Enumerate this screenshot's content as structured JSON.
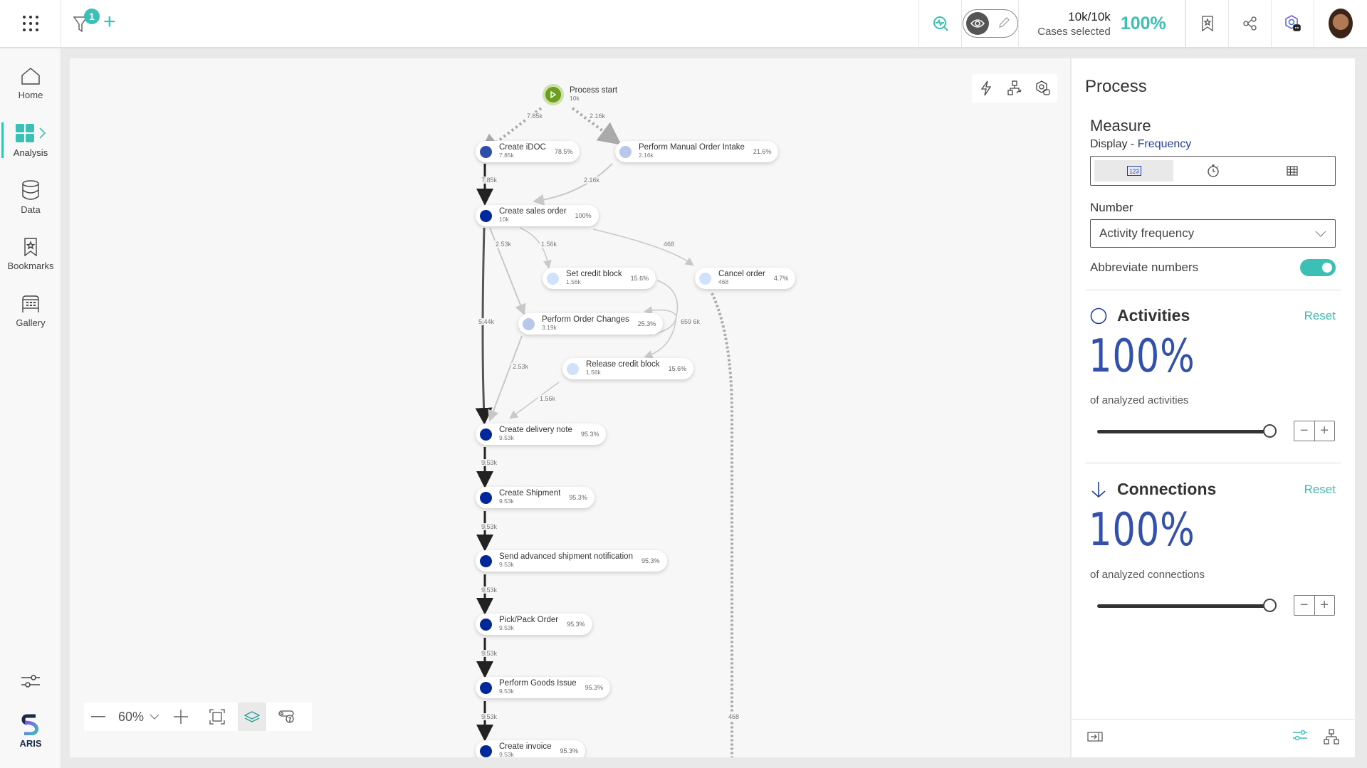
{
  "topbar": {
    "filter_count": "1",
    "cases_count": "10k/10k",
    "cases_label": "Cases selected",
    "cases_percent": "100%",
    "icons": [
      "apps-grid-icon",
      "filter-icon",
      "add-filter-icon",
      "analysis-search-icon",
      "view-mode-eye-icon",
      "edit-mode-pencil-icon",
      "bookmark-icon",
      "share-icon",
      "ai-assistant-icon",
      "user-avatar"
    ]
  },
  "sidebar": {
    "items": [
      {
        "label": "Home",
        "icon": "home-icon"
      },
      {
        "label": "Analysis",
        "icon": "analysis-grid-icon",
        "active": true
      },
      {
        "label": "Data",
        "icon": "database-icon"
      },
      {
        "label": "Bookmarks",
        "icon": "bookmark-icon"
      },
      {
        "label": "Gallery",
        "icon": "gallery-icon"
      }
    ],
    "bottom": {
      "settings_icon": "sliders-icon",
      "logo_label": "ARIS"
    }
  },
  "canvas": {
    "start": {
      "name": "Process start",
      "count": "10k"
    },
    "nodes": [
      {
        "id": "idoc",
        "name": "Create iDOC",
        "count": "7.85k",
        "pct": "78.5%",
        "color": "#2e4ea8"
      },
      {
        "id": "manual",
        "name": "Perform Manual Order Intake",
        "count": "2.16k",
        "pct": "21.6%",
        "color": "#b9c8ea"
      },
      {
        "id": "sales",
        "name": "Create sales order",
        "count": "10k",
        "pct": "100%",
        "color": "#00289a"
      },
      {
        "id": "setcb",
        "name": "Set credit block",
        "count": "1.56k",
        "pct": "15.6%",
        "color": "#cfe1fb"
      },
      {
        "id": "cancel",
        "name": "Cancel order",
        "count": "468",
        "pct": "4.7%",
        "color": "#cfe1fb"
      },
      {
        "id": "changes",
        "name": "Perform Order Changes",
        "count": "3.19k",
        "pct": "25.3%",
        "color": "#b9c8ea"
      },
      {
        "id": "relcb",
        "name": "Release credit block",
        "count": "1.56k",
        "pct": "15.6%",
        "color": "#cfe1fb"
      },
      {
        "id": "delivery",
        "name": "Create delivery note",
        "count": "9.53k",
        "pct": "95.3%",
        "color": "#00289a"
      },
      {
        "id": "shipment",
        "name": "Create Shipment",
        "count": "9.53k",
        "pct": "95.3%",
        "color": "#00289a"
      },
      {
        "id": "asn",
        "name": "Send advanced shipment notification",
        "count": "9.53k",
        "pct": "95.3%",
        "color": "#00289a"
      },
      {
        "id": "pick",
        "name": "Pick/Pack Order",
        "count": "9.53k",
        "pct": "95.3%",
        "color": "#00289a"
      },
      {
        "id": "goods",
        "name": "Perform Goods Issue",
        "count": "9.53k",
        "pct": "95.3%",
        "color": "#00289a"
      },
      {
        "id": "invoice",
        "name": "Create invoice",
        "count": "9.53k",
        "pct": "95.3%",
        "color": "#00289a"
      }
    ],
    "edge_labels": [
      "7.85k",
      "2.16k",
      "7.85k",
      "2.16k",
      "2.53k",
      "1.56k",
      "468",
      "5.44k",
      "659 6k",
      "2.53k",
      "1.56k",
      "9.53k",
      "9.53k",
      "9.53k",
      "9.53k",
      "9.53k",
      "468"
    ],
    "float_tools": [
      "lightning-icon",
      "process-flow-icon",
      "ai-settings-icon"
    ],
    "zoom": {
      "value": "60%"
    }
  },
  "panel": {
    "title": "Process",
    "measure": "Measure",
    "display_prefix": "Display - ",
    "display_value": "Frequency",
    "display_options": [
      "number-icon",
      "stopwatch-icon",
      "table-icon"
    ],
    "number_label": "Number",
    "number_select": "Activity frequency",
    "abbreviate_label": "Abbreviate numbers",
    "abbreviate_on": true,
    "activities": {
      "title": "Activities",
      "reset": "Reset",
      "value": "100%",
      "sub": "of analyzed activities",
      "slider_fraction": 1.0
    },
    "connections": {
      "title": "Connections",
      "reset": "Reset",
      "value": "100%",
      "sub": "of analyzed connections",
      "slider_fraction": 1.0
    }
  }
}
